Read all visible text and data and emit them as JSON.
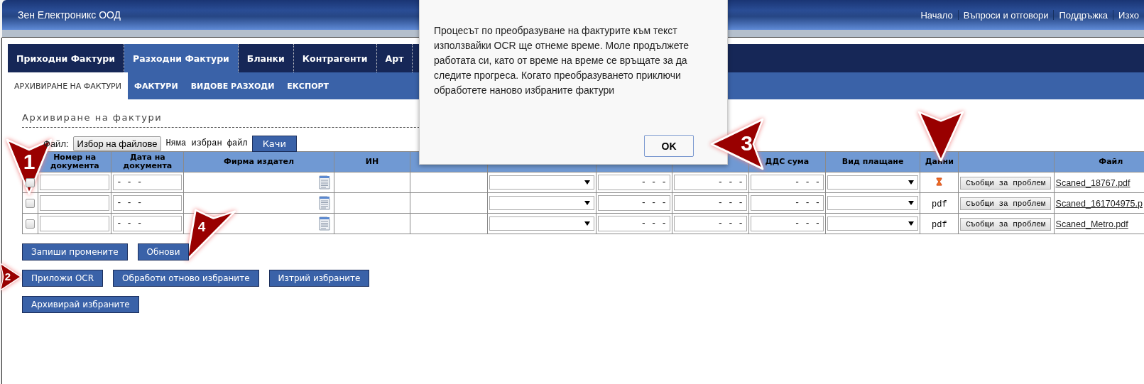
{
  "header": {
    "company": "Зен Електроникс ООД",
    "links": [
      "Начало",
      "Въпроси и отговори",
      "Поддръжка",
      "Изхо"
    ]
  },
  "tabs": [
    {
      "label": "Приходни Фактури",
      "selected": false
    },
    {
      "label": "Разходни Фактури",
      "selected": true
    },
    {
      "label": "Бланки",
      "selected": false
    },
    {
      "label": "Контрагенти",
      "selected": false
    },
    {
      "label": "Арт",
      "selected": false
    }
  ],
  "subtabs": [
    {
      "label": "АРХИВИРАНЕ НА ФАКТУРИ",
      "selected": true
    },
    {
      "label": "ФАКТУРИ",
      "selected": false
    },
    {
      "label": "ВИДОВЕ РАЗХОДИ",
      "selected": false
    },
    {
      "label": "ЕКСПОРТ",
      "selected": false
    }
  ],
  "section_title": "Архивиране на фактури",
  "upload": {
    "label": "Файл:",
    "choose_button": "Избор на файлове",
    "status": "Няма избран файл",
    "upload_button": "Качи"
  },
  "table": {
    "columns": [
      "Номер на документа",
      "Дата на документа",
      "Фирма издател",
      "ИН",
      "ДДС сума",
      "Вид плащане",
      "Данни",
      "Файл"
    ],
    "rows": [
      {
        "checked": false,
        "date": "- - -",
        "total": "- - -",
        "net": "- - -",
        "vat": "- - -",
        "data": {
          "kind": "pending"
        },
        "action": "Съобщи за проблем",
        "file": "Scaned_18767.pdf"
      },
      {
        "checked": false,
        "date": "- - -",
        "total": "- - -",
        "net": "- - -",
        "vat": "- - -",
        "data": {
          "kind": "text",
          "text": "pdf"
        },
        "action": "Съобщи за проблем",
        "file": "Scaned_161704975.p"
      },
      {
        "checked": false,
        "date": "- - -",
        "total": "- - -",
        "net": "- - -",
        "vat": "- - -",
        "data": {
          "kind": "text",
          "text": "pdf"
        },
        "action": "Съобщи за проблем",
        "file": "Scaned_Metro.pdf"
      }
    ]
  },
  "button_rows": [
    [
      "Запиши промените",
      "Обнови"
    ],
    [
      "Приложи OCR",
      "Обработи отново избраните",
      "Изтрий избраните"
    ],
    [
      "Архивирай избраните"
    ]
  ],
  "dialog": {
    "message": "Процесът по преобразуване на фактурите към текст използвайки OCR ще отнеме време. Моле продължете работата си, като от време на време се връщате за да следите прогреса. Когато преобразуването приключи обработете наново избраните фактури",
    "ok_button": "OK"
  },
  "callouts": [
    {
      "number": "1",
      "kind": "down"
    },
    {
      "number": "2",
      "kind": "right"
    },
    {
      "number": "3",
      "kind": "left"
    },
    {
      "number": "4",
      "kind": "down-left"
    },
    {
      "kind": "down"
    }
  ]
}
